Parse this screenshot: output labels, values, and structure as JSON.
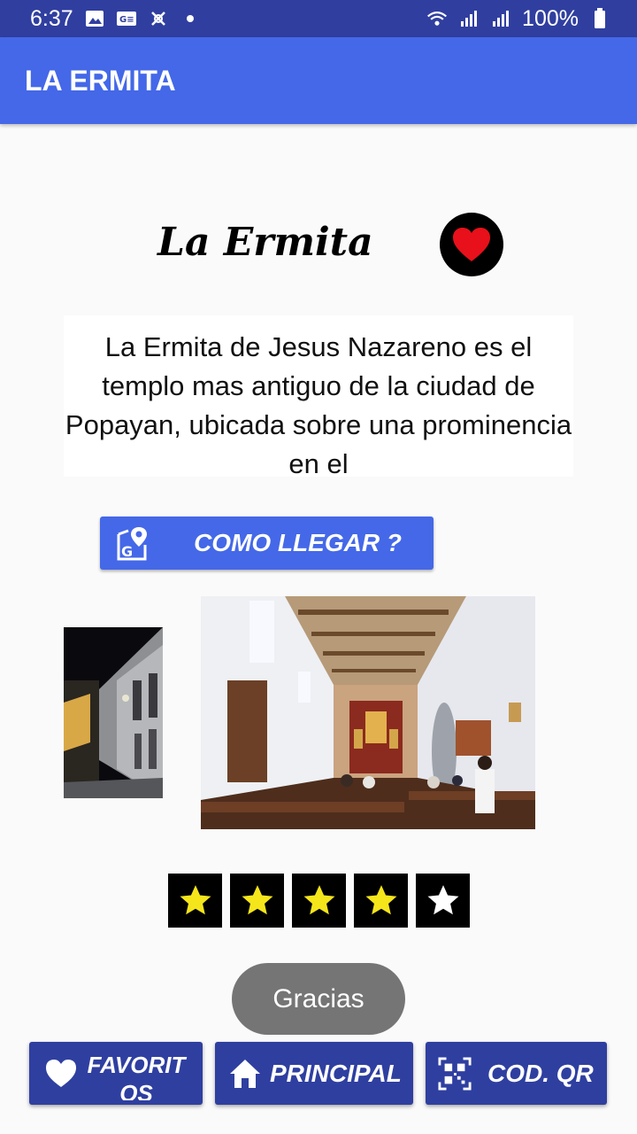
{
  "status_bar": {
    "time": "6:37",
    "battery": "100%",
    "left_icons": [
      "image-icon",
      "news-icon",
      "sync-off-icon",
      "dot-icon"
    ],
    "right_icons": [
      "wifi-icon",
      "signal-icon",
      "signal-icon",
      "battery-icon"
    ]
  },
  "app_bar": {
    "title": "LA ERMITA",
    "color": "#4468e8"
  },
  "place": {
    "title": "La Ermita",
    "favorite": true,
    "description": "La Ermita de Jesus Nazareno es el templo mas antiguo de la ciudad de Popayan, ubicada sobre una prominencia en el"
  },
  "route_button": {
    "label": "COMO LLEGAR ?",
    "icon": "google-maps-icon"
  },
  "images": [
    {
      "name": "street-night-photo"
    },
    {
      "name": "church-interior-photo"
    }
  ],
  "rating": {
    "value": 4,
    "max": 5,
    "filled_color": "#f5e51b",
    "empty_color": "#ffffff"
  },
  "toast": {
    "text": "Gracias"
  },
  "bottom_nav": {
    "favorites": {
      "label": "FAVORITOS",
      "icon": "heart-icon"
    },
    "home": {
      "label": "PRINCIPAL",
      "icon": "home-icon"
    },
    "qr": {
      "label": "COD. QR",
      "icon": "qr-code-icon"
    }
  }
}
